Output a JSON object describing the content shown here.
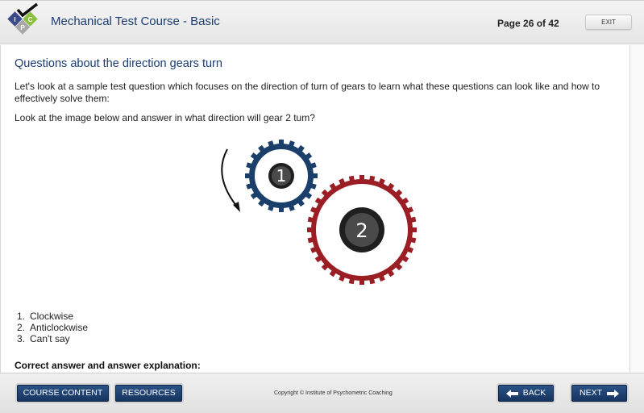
{
  "header": {
    "logo_letters": [
      "I",
      "P",
      "C"
    ],
    "course_title": "Mechanical Test Course - Basic",
    "page_indicator": "Page 26 of 42",
    "exit_label": "EXIT"
  },
  "content": {
    "section_title": "Questions about the direction gears turn",
    "intro_text": "Let's look at a sample test question which focuses on the direction of turn of gears to learn what these questions can look like and how to effectively solve them:",
    "question_text": "Look at the image below and answer in what direction will gear 2 tum?",
    "figure": {
      "gears": [
        {
          "label": "1",
          "color": "#1b3f6b",
          "teeth": 20
        },
        {
          "label": "2",
          "color": "#9a1e24",
          "teeth": 32
        }
      ],
      "arrow_direction": "anticlockwise"
    },
    "options": [
      {
        "num": "1.",
        "label": "Clockwise"
      },
      {
        "num": "2.",
        "label": "Anticlockwise"
      },
      {
        "num": "3.",
        "label": "Can't say"
      }
    ],
    "answer_heading": "Correct answer and answer explanation:"
  },
  "footer": {
    "course_content_label": "COURSE CONTENT",
    "resources_label": "RESOURCES",
    "copyright": "Copyright © Institute of Psychometric Coaching",
    "back_label": "BACK",
    "next_label": "NEXT"
  },
  "colors": {
    "brand_navy": "#1c3d72",
    "button_navy": "#1f406e",
    "gear1": "#1b3f6b",
    "gear2": "#9a1e24"
  }
}
